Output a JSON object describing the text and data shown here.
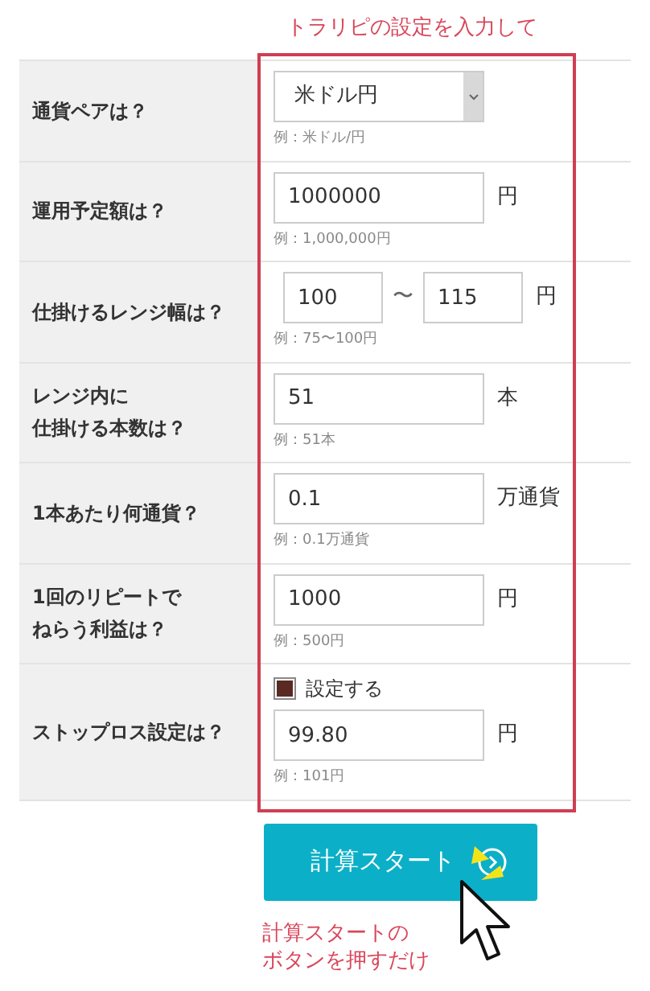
{
  "annotation_top": "トラリピの設定を入力して",
  "rows": [
    {
      "kind": "select",
      "label": [
        "通貨ペアは？"
      ],
      "value": "米ドル円",
      "hint": "例：米ドル/円"
    },
    {
      "kind": "amount",
      "label": [
        "運用予定額は？"
      ],
      "value": "1000000",
      "unit": "円",
      "hint": "例：1,000,000円"
    },
    {
      "kind": "range",
      "label": [
        "仕掛けるレンジ幅は？"
      ],
      "value": "100",
      "separator": "〜",
      "value_to": "115",
      "unit": "円",
      "hint": "例：75〜100円"
    },
    {
      "kind": "amount",
      "label": [
        "レンジ内に",
        "仕掛ける本数は？"
      ],
      "value": "51",
      "unit": "本",
      "hint": "例：51本"
    },
    {
      "kind": "amount",
      "label": [
        "1本あたり何通貨？"
      ],
      "value": "0.1",
      "unit": "万通貨",
      "hint": "例：0.1万通貨"
    },
    {
      "kind": "amount",
      "label": [
        "1回のリピートで",
        "ねらう利益は？"
      ],
      "value": "1000",
      "unit": "円",
      "hint": "例：500円"
    },
    {
      "kind": "checkbox_amount",
      "label": [
        "ストップロス設定は？"
      ],
      "checkbox_label": "設定する",
      "checked": true,
      "value": "99.80",
      "unit": "円",
      "hint": "例：101円"
    }
  ],
  "button": "計算スタート",
  "annotation_bottom": [
    "計算スタートの",
    "ボタンを押すだけ"
  ]
}
